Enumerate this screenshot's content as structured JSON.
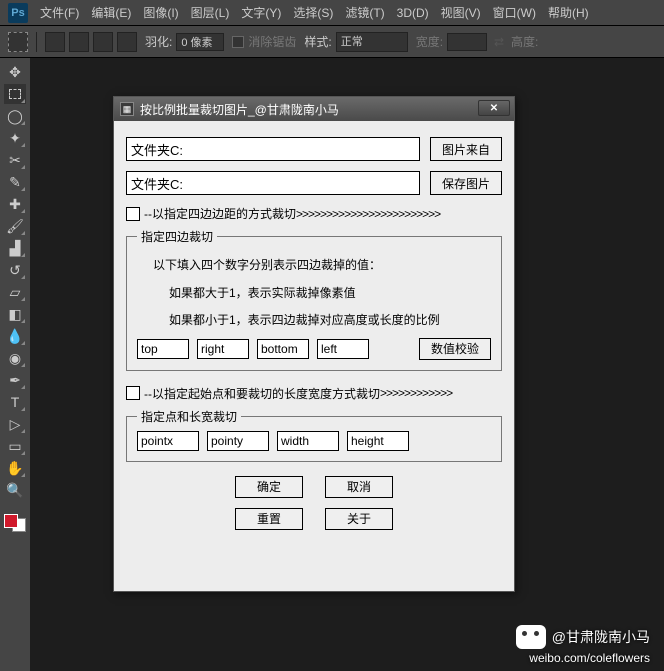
{
  "menubar": {
    "items": [
      "文件(F)",
      "编辑(E)",
      "图像(I)",
      "图层(L)",
      "文字(Y)",
      "选择(S)",
      "滤镜(T)",
      "3D(D)",
      "视图(V)",
      "窗口(W)",
      "帮助(H)"
    ]
  },
  "optionbar": {
    "feather_label": "羽化:",
    "feather_value": "0 像素",
    "antialias_label": "消除锯齿",
    "style_label": "样式:",
    "style_value": "正常",
    "width_label": "宽度:",
    "height_label": "高度:"
  },
  "dialog": {
    "title": "按比例批量裁切图片_@甘肃陇南小马",
    "folder1_label": "文件夹C:",
    "folder2_label": "文件夹C:",
    "btn_source": "图片来自",
    "btn_save": "保存图片",
    "chk1_label": "--以指定四边边距的方式裁切",
    "arrows": ">>>>>>>>>>>>>>>>>>>>>>>>",
    "fieldset1": {
      "legend": "指定四边裁切",
      "hint1": "以下填入四个数字分别表示四边裁掉的值：",
      "hint2": "如果都大于1，表示实际裁掉像素值",
      "hint3": "如果都小于1，表示四边裁掉对应高度或长度的比例",
      "top": "top",
      "right": "right",
      "bottom": "bottom",
      "left": "left",
      "verify": "数值校验"
    },
    "chk2_label": "--以指定起始点和要裁切的长度宽度方式裁切",
    "arrows2": ">>>>>>>>>>>>",
    "fieldset2": {
      "legend": "指定点和长宽裁切",
      "px": "pointx",
      "py": "pointy",
      "w": "width",
      "h": "height"
    },
    "btn_ok": "确定",
    "btn_cancel": "取消",
    "btn_reset": "重置",
    "btn_about": "关于"
  },
  "watermark": {
    "name": "@甘肃陇南小马",
    "url": "weibo.com/coleflowers"
  }
}
